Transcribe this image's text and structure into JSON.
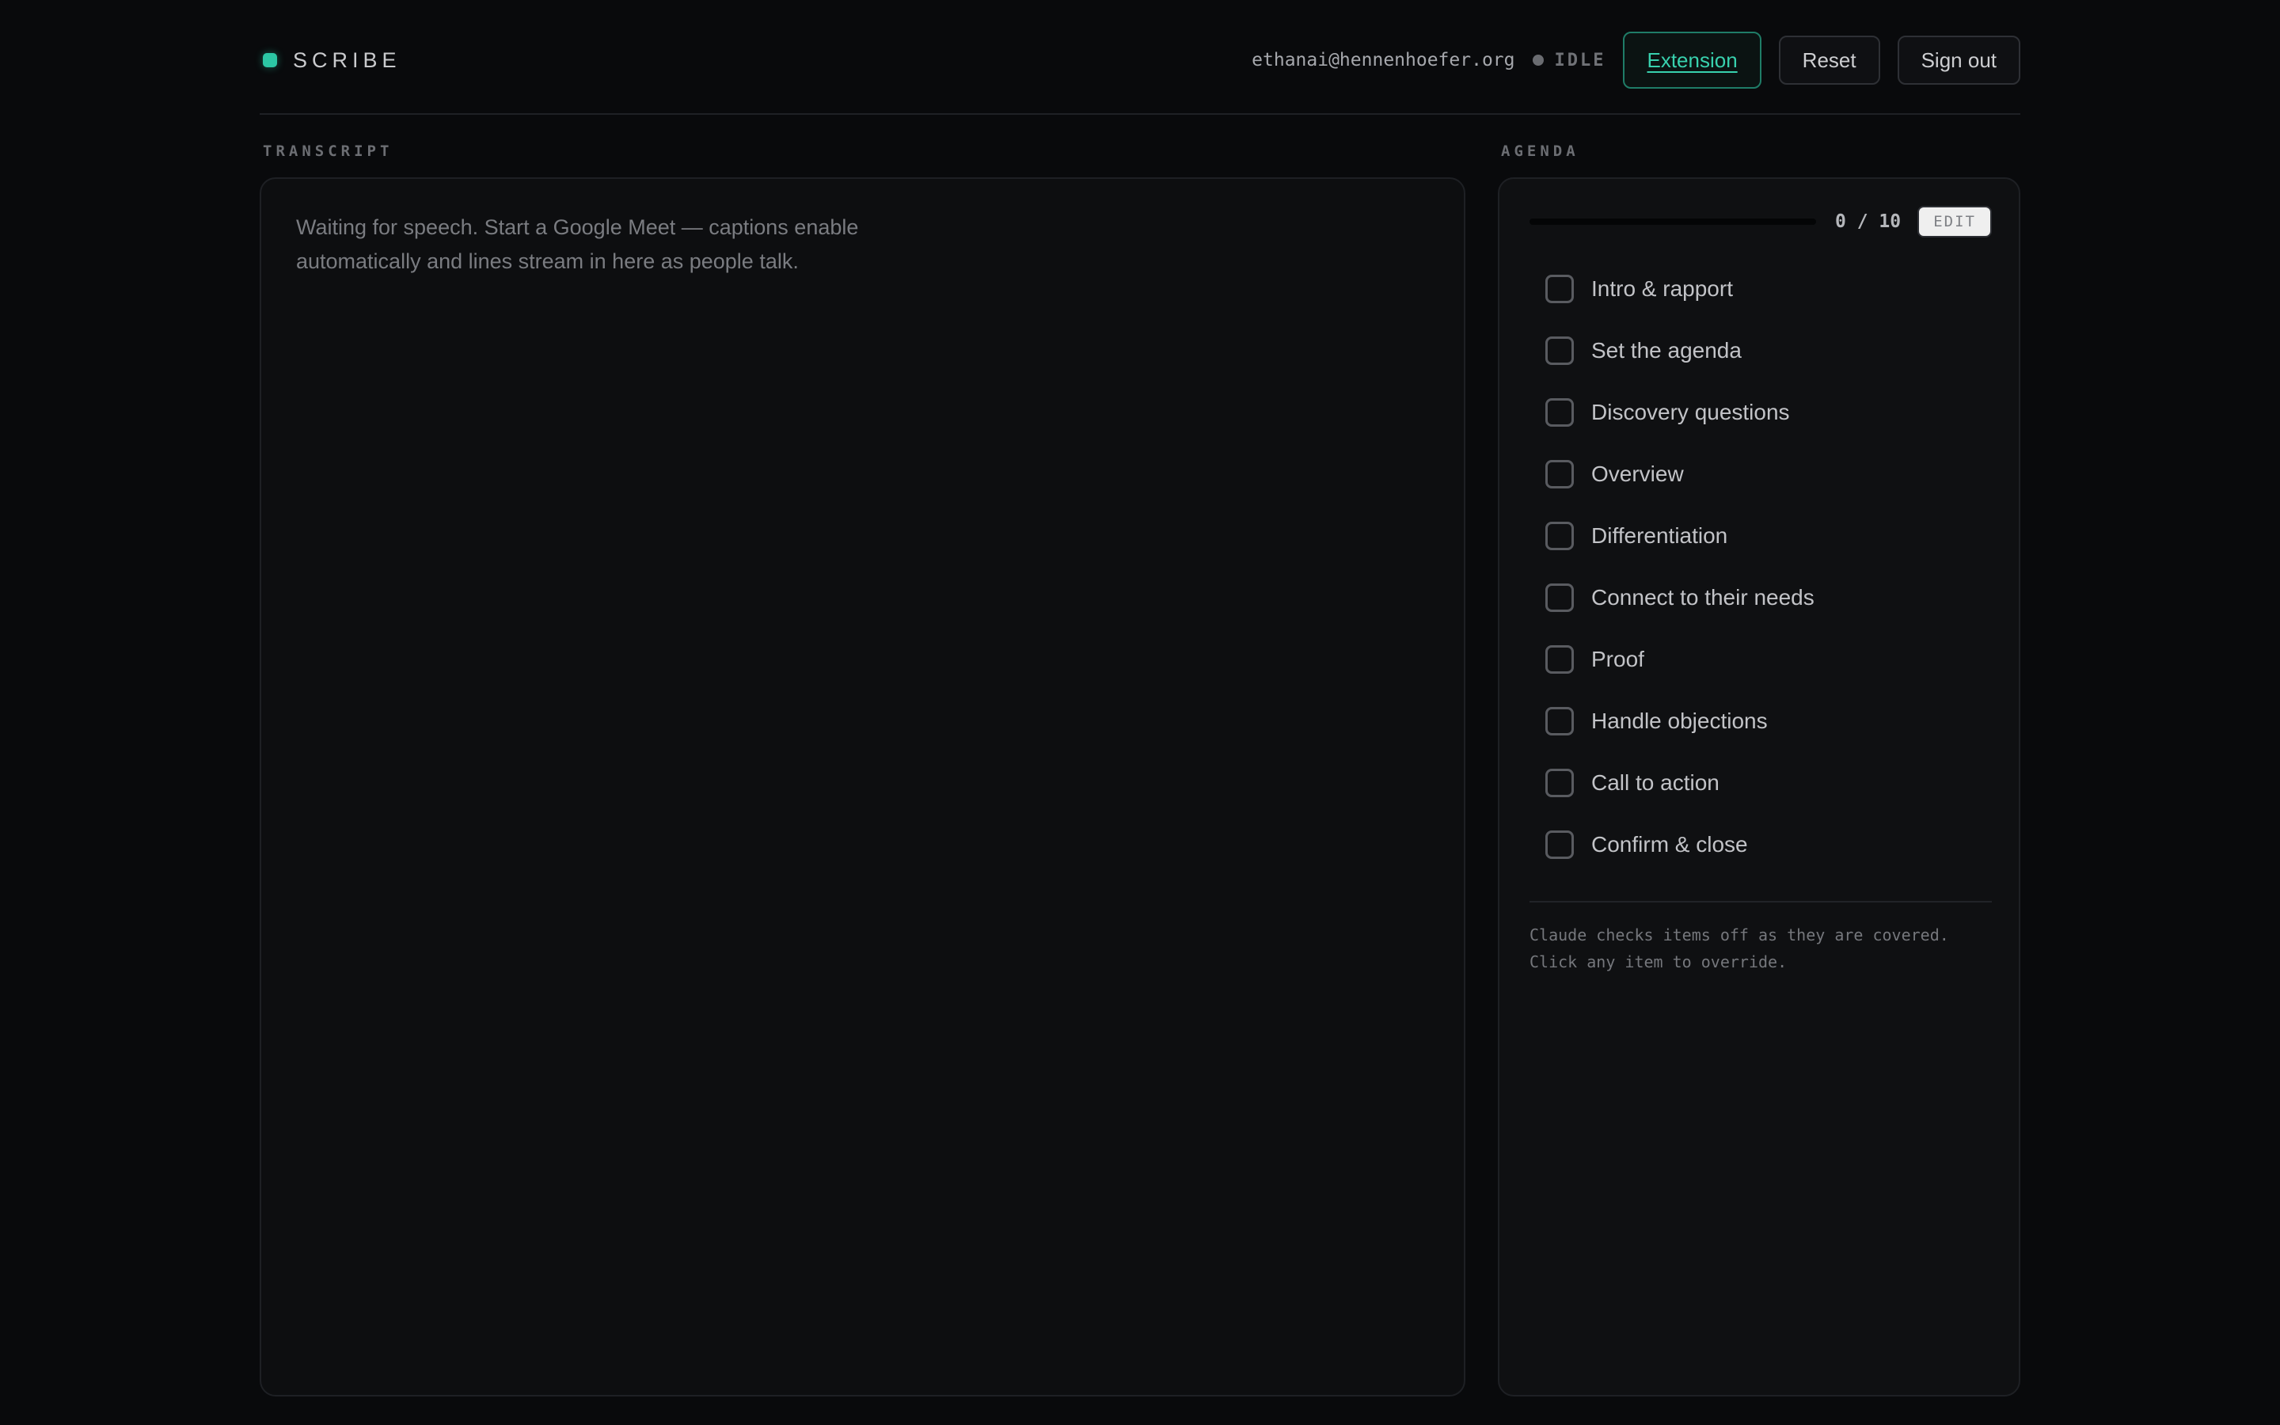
{
  "header": {
    "brand": "SCRIBE",
    "user_email": "ethanai@hennenhoefer.org",
    "status": "IDLE",
    "extension_label": "Extension",
    "reset_label": "Reset",
    "signout_label": "Sign out"
  },
  "transcript": {
    "label": "TRANSCRIPT",
    "placeholder": "Waiting for speech. Start a Google Meet — captions enable automatically and lines stream in here as people talk."
  },
  "agenda": {
    "label": "AGENDA",
    "progress_text": "0 / 10",
    "completed": 0,
    "total": 10,
    "edit_label": "EDIT",
    "items": [
      {
        "label": "Intro & rapport",
        "checked": false
      },
      {
        "label": "Set the agenda",
        "checked": false
      },
      {
        "label": "Discovery questions",
        "checked": false
      },
      {
        "label": "Overview",
        "checked": false
      },
      {
        "label": "Differentiation",
        "checked": false
      },
      {
        "label": "Connect to their needs",
        "checked": false
      },
      {
        "label": "Proof",
        "checked": false
      },
      {
        "label": "Handle objections",
        "checked": false
      },
      {
        "label": "Call to action",
        "checked": false
      },
      {
        "label": "Confirm & close",
        "checked": false
      }
    ],
    "note": "Claude checks items off as they are covered. Click any item to override."
  },
  "colors": {
    "accent": "#2cc6a4",
    "background": "#090a0c",
    "panel": "#0d0e10"
  }
}
